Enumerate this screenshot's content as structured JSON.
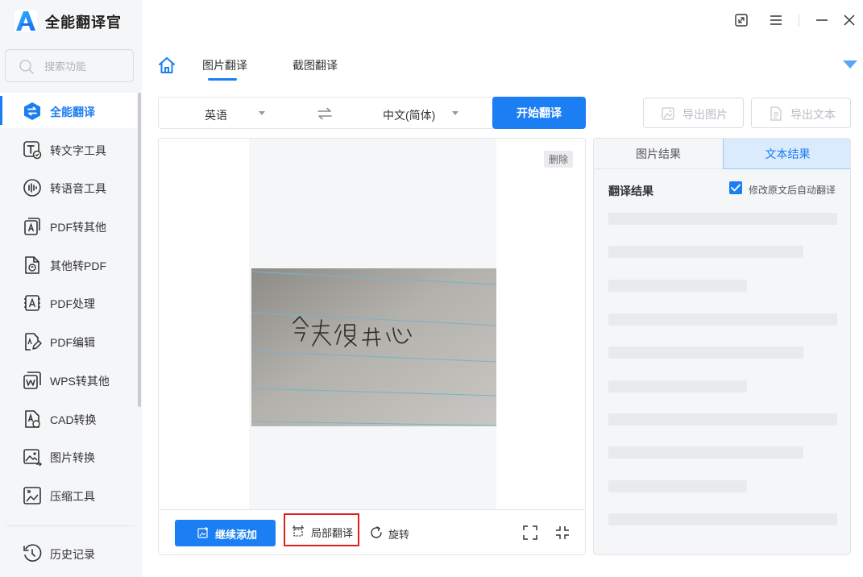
{
  "app": {
    "name": "全能翻译官",
    "brand_color": "#1b7ef2"
  },
  "search": {
    "placeholder": "搜索功能",
    "value": ""
  },
  "sidebar": {
    "items": [
      {
        "label": "全能翻译",
        "icon": "translate-icon",
        "active": true
      },
      {
        "label": "转文字工具",
        "icon": "text-convert-icon",
        "active": false
      },
      {
        "label": "转语音工具",
        "icon": "voice-icon",
        "active": false
      },
      {
        "label": "PDF转其他",
        "icon": "pdf-export-icon",
        "active": false
      },
      {
        "label": "其他转PDF",
        "icon": "to-pdf-icon",
        "active": false
      },
      {
        "label": "PDF处理",
        "icon": "pdf-process-icon",
        "active": false
      },
      {
        "label": "PDF编辑",
        "icon": "pdf-edit-icon",
        "active": false
      },
      {
        "label": "WPS转其他",
        "icon": "wps-icon",
        "active": false
      },
      {
        "label": "CAD转换",
        "icon": "cad-icon",
        "active": false
      },
      {
        "label": "图片转换",
        "icon": "image-convert-icon",
        "active": false
      },
      {
        "label": "压缩工具",
        "icon": "compress-icon",
        "active": false
      }
    ],
    "history": {
      "label": "历史记录",
      "icon": "history-icon"
    }
  },
  "tabs": [
    {
      "label": "图片翻译",
      "active": true
    },
    {
      "label": "截图翻译",
      "active": false
    }
  ],
  "language": {
    "source": "英语",
    "target": "中文(简体)"
  },
  "actions": {
    "start": "开始翻译",
    "export_image": "导出图片",
    "export_text": "导出文本"
  },
  "image_panel": {
    "delete": "删除",
    "continue_add": "继续添加",
    "local_translate": "局部翻译",
    "rotate": "旋转"
  },
  "result_panel": {
    "tab_image": "图片结果",
    "tab_text": "文本结果",
    "title": "翻译结果",
    "auto_translate_label": "修改原文后自动翻译",
    "auto_translate_checked": true
  }
}
